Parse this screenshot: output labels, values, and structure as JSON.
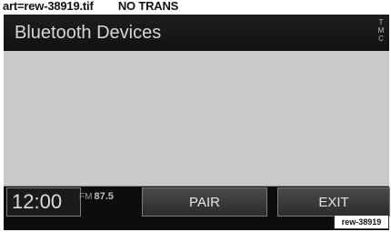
{
  "caption": "art=rew-38919.tif        NO TRANS",
  "header": {
    "title": "Bluetooth Devices",
    "tmc": [
      "T",
      "M",
      "C"
    ]
  },
  "status": {
    "time": "12:00",
    "band": "FM",
    "frequency": "87.5"
  },
  "buttons": {
    "pair": "PAIR",
    "exit": "EXIT"
  },
  "image_tag": "rew-38919"
}
